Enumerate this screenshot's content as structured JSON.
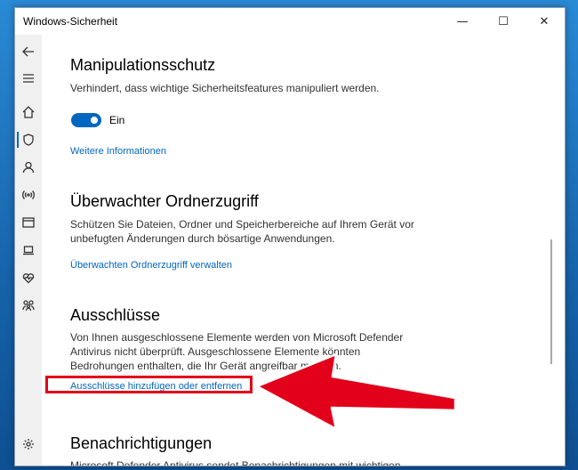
{
  "window": {
    "title": "Windows-Sicherheit",
    "minimize_symbol": "—",
    "maximize_symbol": "☐",
    "close_symbol": "✕"
  },
  "sidebar": {
    "items": [
      {
        "icon": "back-arrow-icon"
      },
      {
        "icon": "hamburger-menu-icon"
      },
      {
        "icon": "home-icon"
      },
      {
        "icon": "shield-icon",
        "active": true
      },
      {
        "icon": "person-icon"
      },
      {
        "icon": "wifi-antenna-icon"
      },
      {
        "icon": "browser-window-icon"
      },
      {
        "icon": "laptop-icon"
      },
      {
        "icon": "heart-icon"
      },
      {
        "icon": "family-icon"
      },
      {
        "icon": "gear-icon"
      }
    ]
  },
  "sections": {
    "tamper": {
      "title": "Manipulationsschutz",
      "description": "Verhindert, dass wichtige Sicherheitsfeatures manipuliert werden.",
      "toggle_state": "Ein",
      "link": "Weitere Informationen"
    },
    "folder_access": {
      "title": "Überwachter Ordnerzugriff",
      "description_line1": "Schützen Sie Dateien, Ordner und Speicherbereiche auf Ihrem Gerät vor",
      "description_line2": "unbefugten Änderungen durch bösartige Anwendungen.",
      "link": "Überwachten Ordnerzugriff verwalten"
    },
    "exclusions": {
      "title": "Ausschlüsse",
      "description_line1": "Von Ihnen ausgeschlossene Elemente werden von Microsoft Defender",
      "description_line2": "Antivirus nicht überprüft. Ausgeschlossene Elemente könnten",
      "description_line3": "Bedrohungen enthalten, die Ihr Gerät angreifbar machen.",
      "link": "Ausschlüsse hinzufügen oder entfernen"
    },
    "notifications": {
      "title": "Benachrichtigungen",
      "description_line1": "Microsoft Defender Antivirus sendet Benachrichtigungen mit wichtigen"
    }
  },
  "colors": {
    "accent": "#0067c0",
    "annotation_red": "#e2001a"
  }
}
